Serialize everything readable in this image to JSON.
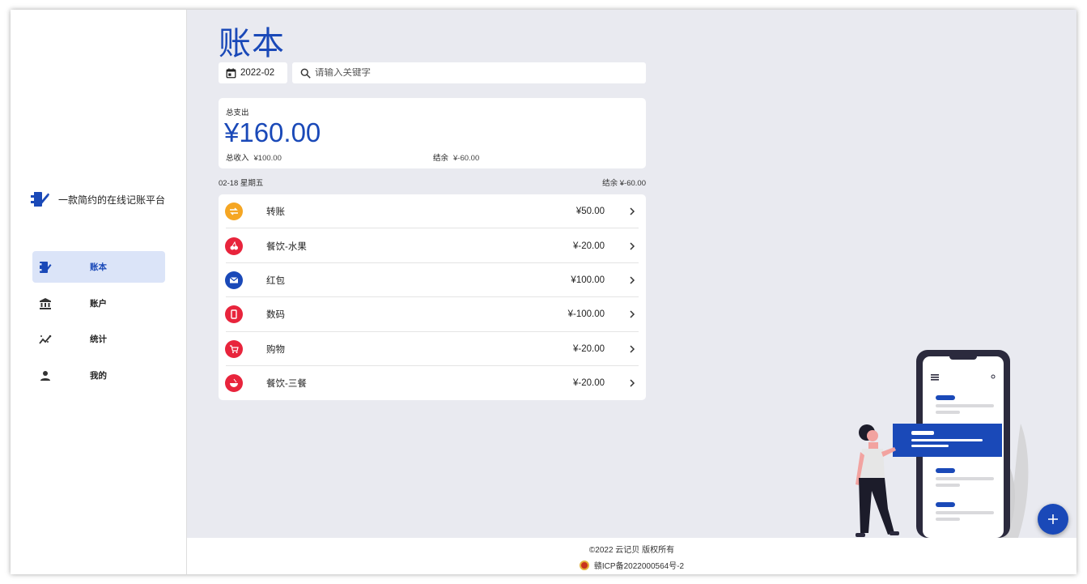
{
  "app": {
    "slogan": "一款简约的在线记账平台",
    "accent_color": "#1a49b8"
  },
  "sidebar": {
    "items": [
      {
        "label": "账本",
        "icon": "ledger-icon",
        "active": true
      },
      {
        "label": "账户",
        "icon": "bank-icon",
        "active": false
      },
      {
        "label": "统计",
        "icon": "chart-icon",
        "active": false
      },
      {
        "label": "我的",
        "icon": "person-icon",
        "active": false
      }
    ]
  },
  "main": {
    "title": "账本",
    "month": "2022-02",
    "search_placeholder": "请输入关键字"
  },
  "summary": {
    "expense_label": "总支出",
    "expense_amount": "¥160.00",
    "income_label": "总收入",
    "income_amount": "¥100.00",
    "balance_label": "结余",
    "balance_amount": "¥-60.00"
  },
  "day": {
    "date": "02-18 星期五",
    "balance": "结余 ¥-60.00"
  },
  "transactions": [
    {
      "name": "转账",
      "amount": "¥50.00",
      "icon": "transfer-icon",
      "color": "#f5a623"
    },
    {
      "name": "餐饮-水果",
      "amount": "¥-20.00",
      "icon": "fruit-icon",
      "color": "#e8243c"
    },
    {
      "name": "红包",
      "amount": "¥100.00",
      "icon": "envelope-icon",
      "color": "#1a49b8"
    },
    {
      "name": "数码",
      "amount": "¥-100.00",
      "icon": "phone-icon",
      "color": "#e8243c"
    },
    {
      "name": "购物",
      "amount": "¥-20.00",
      "icon": "cart-icon",
      "color": "#e8243c"
    },
    {
      "name": "餐饮-三餐",
      "amount": "¥-20.00",
      "icon": "bowl-icon",
      "color": "#e8243c"
    }
  ],
  "footer": {
    "copyright": "©2022 云记贝 版权所有",
    "icp": "赣ICP备2022000564号-2"
  }
}
